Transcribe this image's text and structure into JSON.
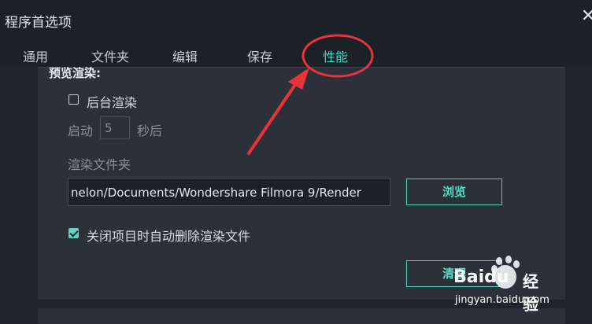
{
  "window": {
    "title": "程序首选项",
    "close_glyph": "✕"
  },
  "tabs": [
    {
      "label": "通用",
      "active": false
    },
    {
      "label": "文件夹",
      "active": false
    },
    {
      "label": "编辑",
      "active": false
    },
    {
      "label": "保存",
      "active": false
    },
    {
      "label": "性能",
      "active": true
    }
  ],
  "preview_render": {
    "section_title": "预览渲染:",
    "background_render_label": "后台渲染",
    "background_render_checked": false,
    "start_label": "启动",
    "start_value": "5",
    "seconds_label": "秒后",
    "folder_label": "渲染文件夹",
    "folder_path": "nelon/Documents/Wondershare Filmora 9/Render",
    "browse_button": "浏览",
    "auto_delete_label": "关闭项目时自动删除渲染文件",
    "auto_delete_checked": true,
    "clear_button": "清理"
  },
  "annotation": {
    "color": "#e8333a"
  },
  "watermark": {
    "brand": "Baidu",
    "brand_cn": "经验",
    "url": "jingyan.baidu.com"
  },
  "colors": {
    "accent": "#3fd6c2",
    "background": "#1f232a",
    "panel": "#2c3038"
  }
}
